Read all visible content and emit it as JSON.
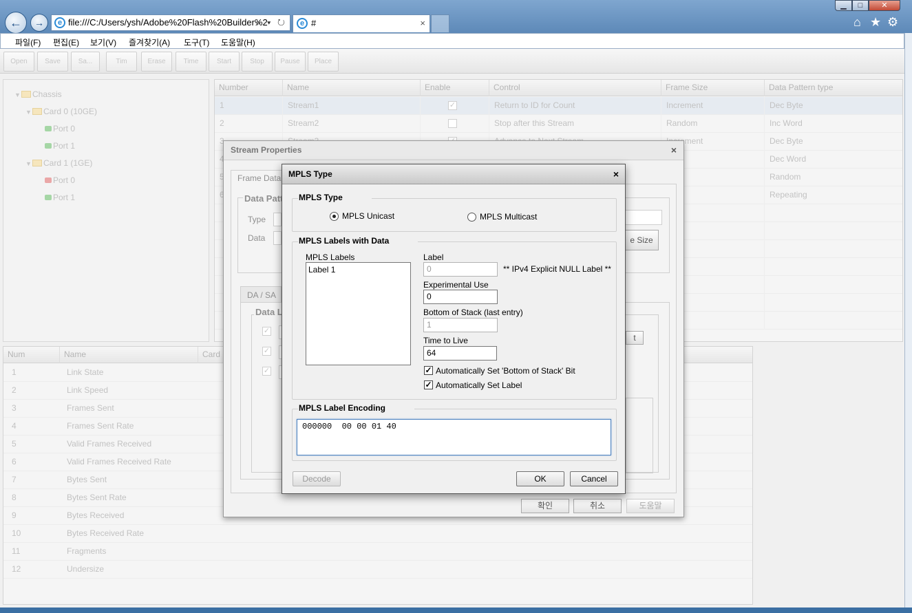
{
  "browser": {
    "address": "file:///C:/Users/ysh/Adobe%20Flash%20Builder%2",
    "tab_title": "#",
    "ie_glyph": "e",
    "addr_tools": "⌕ ▾ ↻",
    "back": "←",
    "forward": "→",
    "close": "×",
    "min": "▁",
    "max": "□",
    "win_close": "✕",
    "home": "⌂",
    "star": "★",
    "gear": "⚙"
  },
  "menu": [
    "파일(F)",
    "편집(E)",
    "보기(V)",
    "즐겨찾기(A)",
    "도구(T)",
    "도움말(H)"
  ],
  "toolbar": [
    "Open",
    "Save",
    "Sa...",
    "Tim",
    "Erase",
    "Time",
    "Start",
    "Stop",
    "Pause",
    "Place"
  ],
  "tree": {
    "chassis": "Chassis",
    "card0": "Card 0 (10GE)",
    "card0_ports": [
      "Port 0",
      "Port 1"
    ],
    "card1": "Card 1 (1GE)",
    "card1_ports": [
      "Port 0",
      "Port 1"
    ]
  },
  "stream_grid": {
    "headers": [
      "Number",
      "Name",
      "Enable",
      "Control",
      "Frame Size",
      "Data Pattern type"
    ],
    "rows": [
      {
        "num": "1",
        "name": "Stream1",
        "enabled": "✓",
        "control": "Return to ID for Count",
        "size": "Increment",
        "pattern": "Dec Byte"
      },
      {
        "num": "2",
        "name": "Stream2",
        "enabled": "",
        "control": "Stop after this Stream",
        "size": "Random",
        "pattern": "Inc Word"
      },
      {
        "num": "3",
        "name": "Stream3",
        "enabled": "✓",
        "control": "Advance to Next Stream",
        "size": "Increment",
        "pattern": "Dec Byte"
      },
      {
        "num": "4",
        "name": "",
        "enabled": "",
        "control": "",
        "size": "",
        "pattern": "Dec Word"
      },
      {
        "num": "5",
        "name": "",
        "enabled": "",
        "control": "",
        "size": "",
        "pattern": "Random"
      },
      {
        "num": "6",
        "name": "",
        "enabled": "",
        "control": "",
        "size": "",
        "pattern": "Repeating"
      }
    ]
  },
  "stats": {
    "headers": [
      "Num",
      "Name",
      "Card"
    ],
    "rows": [
      [
        "1",
        "Link State"
      ],
      [
        "2",
        "Link Speed"
      ],
      [
        "3",
        "Frames Sent"
      ],
      [
        "4",
        "Frames Sent Rate"
      ],
      [
        "5",
        "Valid Frames Received"
      ],
      [
        "6",
        "Valid Frames Received Rate"
      ],
      [
        "7",
        "Bytes Sent"
      ],
      [
        "8",
        "Bytes Sent Rate"
      ],
      [
        "9",
        "Bytes Received"
      ],
      [
        "10",
        "Bytes Received Rate"
      ],
      [
        "11",
        "Fragments"
      ],
      [
        "12",
        "Undersize"
      ]
    ]
  },
  "stream_dialog": {
    "title": "Stream Properties",
    "tab": "Frame Data",
    "pattern_group": "Data Patt",
    "type_label": "Type",
    "data_label": "Data",
    "size_btn": "e Size",
    "sub_tab": "DA / SA",
    "data_group": "Data L",
    "t_btn": "t",
    "ok": "확인",
    "cancel": "취소",
    "help": "도움말"
  },
  "mpls_dialog": {
    "title": "MPLS Type",
    "type_group": "MPLS Type",
    "unicast": "MPLS Unicast",
    "multicast": "MPLS Multicast",
    "labels_group": "MPLS Labels with Data",
    "labels_list_title": "MPLS Labels",
    "labels": [
      "Label 1"
    ],
    "label_caption": "Label",
    "label_value": "0",
    "label_note": "** IPv4 Explicit NULL Label **",
    "exp_caption": "Experimental Use",
    "exp_value": "0",
    "bos_caption": "Bottom of Stack (last entry)",
    "bos_value": "1",
    "ttl_caption": "Time to Live",
    "ttl_value": "64",
    "auto_bos": "Automatically Set 'Bottom of Stack' Bit",
    "auto_label": "Automatically Set Label",
    "check": "✓",
    "encoding_group": "MPLS Label Encoding",
    "encoding_value": "000000  00 00 01 40",
    "decode": "Decode",
    "ok": "OK",
    "cancel": "Cancel"
  }
}
